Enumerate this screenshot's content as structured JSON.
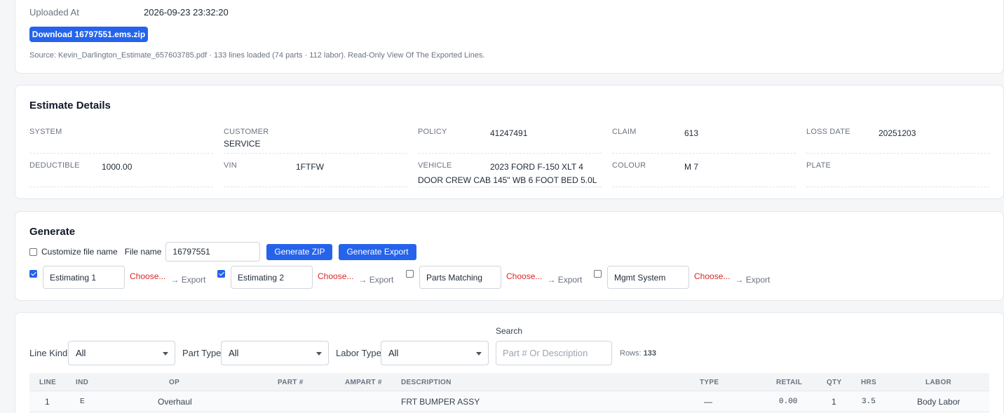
{
  "upload": {
    "uploaded_at_label": "Uploaded At",
    "uploaded_at_value": "2026-09-23 23:32:20",
    "download_label": "Download 16797551.ems.zip",
    "source_line": "Source: Kevin_Darlington_Estimate_657603785.pdf · 133 lines loaded (74 parts · 112 labor). Read-Only View Of The Exported Lines."
  },
  "estimate": {
    "title": "Estimate Details",
    "fields": {
      "system": {
        "label": "System",
        "value": ""
      },
      "customer": {
        "label": "Customer",
        "value": "SERVICE"
      },
      "policy": {
        "label": "Policy",
        "value": "41247491"
      },
      "claim": {
        "label": "Claim",
        "value": "613"
      },
      "loss_date": {
        "label": "Loss Date",
        "value": "20251203"
      },
      "deductible": {
        "label": "Deductible",
        "value": "1000.00"
      },
      "vin": {
        "label": "VIN",
        "value": "1FTFW"
      },
      "vehicle": {
        "label": "Vehicle",
        "value": "2023 FORD F-150 XLT 4 DOOR CREW CAB 145\" WB 6 FOOT BED 5.0L"
      },
      "colour": {
        "label": "Colour",
        "value": "M 7"
      },
      "plate": {
        "label": "Plate",
        "value": ""
      }
    }
  },
  "generate": {
    "title": "Generate",
    "customize_label": "Customize file name",
    "customize_checked": false,
    "file_name_label": "File name",
    "file_name_value": "16797551",
    "zip_button": "Generate ZIP",
    "export_button": "Generate Export",
    "exports": [
      {
        "checked": true,
        "name": "Estimating 1",
        "choose": "Choose...",
        "export": "→ Export"
      },
      {
        "checked": true,
        "name": "Estimating 2",
        "choose": "Choose...",
        "export": "→ Export"
      },
      {
        "checked": false,
        "name": "Parts Matching",
        "choose": "Choose...",
        "export": "→ Export"
      },
      {
        "checked": false,
        "name": "Mgmt System",
        "choose": "Choose...",
        "export": "→ Export"
      }
    ]
  },
  "lines": {
    "line_kind_label": "Line Kind",
    "line_kind_value": "All",
    "part_type_label": "Part Type",
    "part_type_value": "All",
    "labor_type_label": "Labor Type",
    "labor_type_value": "All",
    "search_label": "Search",
    "search_placeholder": "Part # Or Description",
    "rows_label": "Rows:",
    "rows_count": "133",
    "columns": {
      "line": "LINE",
      "ind": "IND",
      "op": "OP",
      "part": "PART #",
      "ampart": "AMPART #",
      "description": "DESCRIPTION",
      "type": "TYPE",
      "retail": "RETAIL",
      "qty": "QTY",
      "hrs": "HRS",
      "labor": "LABOR"
    },
    "rows": [
      {
        "line": "1",
        "ind": "E",
        "op": "Overhaul",
        "part": "",
        "ampart": "",
        "description": "FRT BUMPER ASSY",
        "type": "—",
        "retail": "0.00",
        "qty": "1",
        "hrs": "3.5",
        "labor": "Body Labor"
      }
    ]
  }
}
